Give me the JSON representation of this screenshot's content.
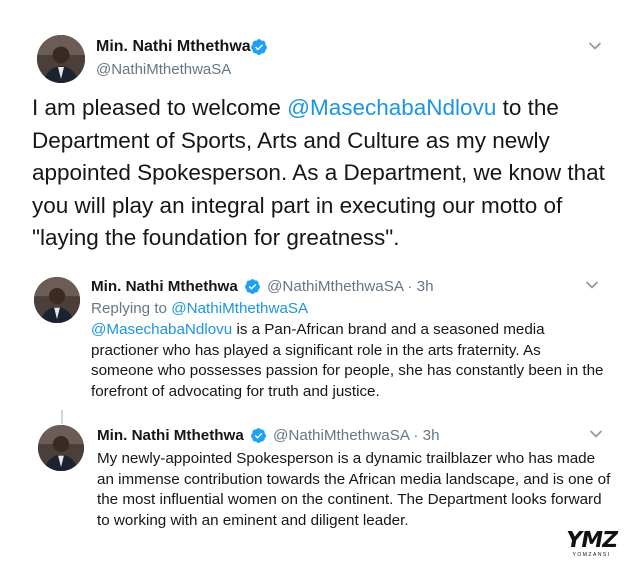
{
  "main_tweet": {
    "name": "Min. Nathi Mthethwa",
    "handle": "@NathiMthethwaSA",
    "text_before": "I am pleased to welcome ",
    "mention": "@MasechabaNdlovu",
    "text_after": " to the Department of Sports, Arts and Culture as my newly appointed Spokesperson. As a Department, we know that you will play an integral part in executing our motto of \"laying the foundation for greatness\"."
  },
  "reply_1": {
    "name": "Min. Nathi Mthethwa",
    "handle": "@NathiMthethwaSA",
    "dot": "·",
    "time": "3h",
    "replying_label": "Replying to ",
    "replying_handle": "@NathiMthethwaSA",
    "mention": "@MasechabaNdlovu",
    "text": " is a Pan-African brand and a seasoned media practioner who has played a significant role in the arts fraternity. As someone who possesses passion for people, she has constantly been in the forefront of advocating for truth and justice."
  },
  "reply_2": {
    "name": "Min. Nathi Mthethwa",
    "handle": "@NathiMthethwaSA",
    "dot": "·",
    "time": "3h",
    "text": "My newly-appointed Spokesperson is a dynamic trailblazer who has made an immense contribution towards the African media landscape, and is one of the most influential women on the continent. The Department looks forward to working with an eminent and diligent leader."
  },
  "watermark": {
    "main": "YMZ",
    "sub": "YOMZANSI"
  },
  "colors": {
    "link": "#1b95e0",
    "secondary": "#657786",
    "verified": "#1da1f2",
    "text": "#14171a"
  },
  "icons": {
    "verified": "verified-badge-icon",
    "more": "chevron-down-icon"
  }
}
